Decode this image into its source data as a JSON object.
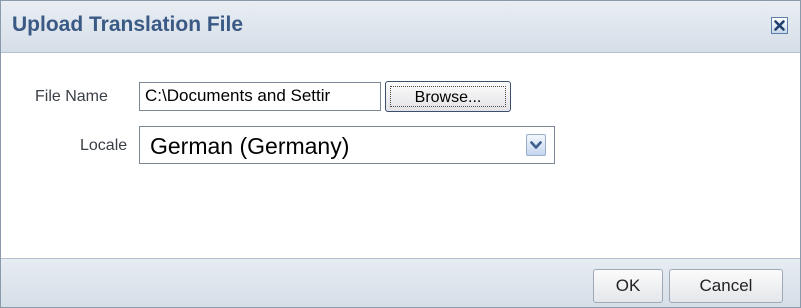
{
  "dialog": {
    "title": "Upload Translation File",
    "close_icon": "close-icon"
  },
  "form": {
    "file_name_label": "File Name",
    "file_name_value": "C:\\Documents and Settir",
    "browse_label": "Browse...",
    "locale_label": "Locale",
    "locale_value": "German (Germany)",
    "dropdown_icon": "chevron-down-icon"
  },
  "footer": {
    "ok_label": "OK",
    "cancel_label": "Cancel"
  },
  "colors": {
    "title_text": "#3a5a85",
    "header_bg": "#dfe6ee",
    "border": "#8a9aab"
  }
}
